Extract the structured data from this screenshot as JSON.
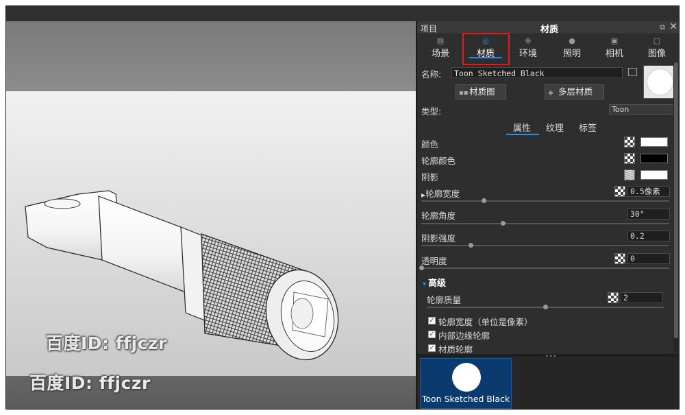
{
  "panel": {
    "project_label": "项目",
    "title": "材质",
    "tabs": [
      {
        "label": "场景",
        "icon": "scene-icon"
      },
      {
        "label": "材质",
        "icon": "material-icon",
        "active": true
      },
      {
        "label": "环境",
        "icon": "globe-icon"
      },
      {
        "label": "照明",
        "icon": "bulb-icon"
      },
      {
        "label": "相机",
        "icon": "camera-icon"
      },
      {
        "label": "图像",
        "icon": "image-icon"
      }
    ],
    "name_label": "名称:",
    "name_value": "Toon Sketched Black",
    "material_graph_button": "材质图",
    "multilayer_button": "多层材质",
    "type_label": "类型:",
    "type_value": "Toon",
    "subtabs": [
      "属性",
      "纹理",
      "标签"
    ],
    "properties": {
      "color": {
        "label": "颜色",
        "swatch": "#ffffff"
      },
      "outline_color": {
        "label": "轮廓颜色",
        "swatch": "#000000"
      },
      "shadow": {
        "label": "阴影",
        "swatch": "#ffffff"
      },
      "outline_width": {
        "label": "轮廓宽度",
        "value": "0.5像素",
        "slider": 0.25
      },
      "outline_angle": {
        "label": "轮廓角度",
        "value": "30°",
        "slider": 0.33
      },
      "shadow_strength": {
        "label": "阴影强度",
        "value": "0.2",
        "slider": 0.2
      },
      "transparency": {
        "label": "透明度",
        "value": "0",
        "slider": 0.0
      }
    },
    "advanced": {
      "label": "高级",
      "outline_quality": {
        "label": "轮廓质量",
        "value": "2",
        "slider": 0.5
      },
      "checkboxes": [
        {
          "label": "轮廓宽度（单位是像素）",
          "checked": true
        },
        {
          "label": "内部边缘轮廓",
          "checked": true
        },
        {
          "label": "材质轮廓",
          "checked": true
        }
      ]
    },
    "library": {
      "items": [
        {
          "label": "Toon Sketched Black"
        }
      ]
    }
  },
  "viewport": {
    "watermark": "百度ID: ffjczr"
  },
  "colors": {
    "accent": "#2f8be6",
    "highlight_box": "#e01b1b",
    "library_selected": "#0b3a6e"
  }
}
